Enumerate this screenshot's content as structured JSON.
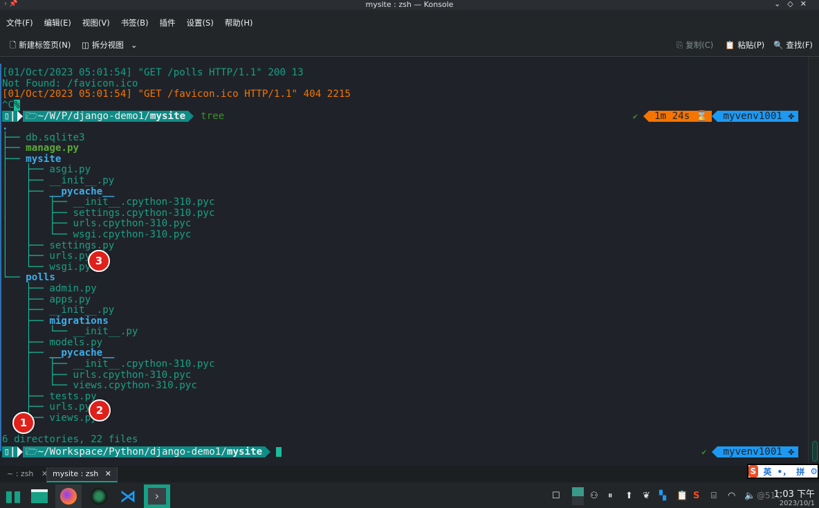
{
  "window": {
    "title": "mysite : zsh — Konsole",
    "controls": [
      "⌄",
      "◇",
      "✕"
    ]
  },
  "menu": [
    "文件(F)",
    "编辑(E)",
    "视图(V)",
    "书签(B)",
    "插件",
    "设置(S)",
    "帮助(H)"
  ],
  "toolbar": {
    "new_tab": "新建标签页(N)",
    "split_view": "拆分视图",
    "copy": "复制(C)",
    "paste": "粘贴(P)",
    "find": "查找(F)"
  },
  "terminal": {
    "log_lines": [
      [
        [
          "[01/Oct/2023 05:01:54] \"GET /polls HTTP/1.1\" 200 13",
          "teal"
        ]
      ],
      [
        [
          "Not Found: /favicon.ico",
          "teal"
        ]
      ],
      [
        [
          "[01/Oct/2023 05:01:54] \"GET /favicon.ico HTTP/1.1\" 404 2215",
          "orange"
        ]
      ],
      [
        [
          "^C",
          "teal"
        ],
        [
          "%",
          "cursor"
        ]
      ]
    ],
    "prompt1": {
      "path_prefix": "~/W/P/django-demo1/",
      "path_dir": "mysite",
      "command": "tree",
      "status": "✔",
      "duration": "1m 24s",
      "venv": "myvenv1001"
    },
    "tree_lines": [
      [
        [
          ".",
          "dir"
        ]
      ],
      [
        [
          "├── ",
          "br"
        ],
        [
          "db.sqlite3",
          "file"
        ]
      ],
      [
        [
          "├── ",
          "br"
        ],
        [
          "manage.py",
          "exec"
        ]
      ],
      [
        [
          "├── ",
          "br"
        ],
        [
          "mysite",
          "dir"
        ]
      ],
      [
        [
          "│   ├── ",
          "br"
        ],
        [
          "asgi.py",
          "file"
        ]
      ],
      [
        [
          "│   ├── ",
          "br"
        ],
        [
          "__init__.py",
          "file"
        ]
      ],
      [
        [
          "│   ├── ",
          "br"
        ],
        [
          "__pycache__",
          "dir"
        ]
      ],
      [
        [
          "│   │   ├── ",
          "br"
        ],
        [
          "__init__.cpython-310.pyc",
          "file"
        ]
      ],
      [
        [
          "│   │   ├── ",
          "br"
        ],
        [
          "settings.cpython-310.pyc",
          "file"
        ]
      ],
      [
        [
          "│   │   ├── ",
          "br"
        ],
        [
          "urls.cpython-310.pyc",
          "file"
        ]
      ],
      [
        [
          "│   │   └── ",
          "br"
        ],
        [
          "wsgi.cpython-310.pyc",
          "file"
        ]
      ],
      [
        [
          "│   ├── ",
          "br"
        ],
        [
          "settings.py",
          "file"
        ]
      ],
      [
        [
          "│   ├── ",
          "br"
        ],
        [
          "urls.py",
          "file"
        ]
      ],
      [
        [
          "│   └── ",
          "br"
        ],
        [
          "wsgi.py",
          "file"
        ]
      ],
      [
        [
          "└── ",
          "br"
        ],
        [
          "polls",
          "dir"
        ]
      ],
      [
        [
          "    ├── ",
          "br"
        ],
        [
          "admin.py",
          "file"
        ]
      ],
      [
        [
          "    ├── ",
          "br"
        ],
        [
          "apps.py",
          "file"
        ]
      ],
      [
        [
          "    ├── ",
          "br"
        ],
        [
          "__init__.py",
          "file"
        ]
      ],
      [
        [
          "    ├── ",
          "br"
        ],
        [
          "migrations",
          "dir"
        ]
      ],
      [
        [
          "    │   └── ",
          "br"
        ],
        [
          "__init__.py",
          "file"
        ]
      ],
      [
        [
          "    ├── ",
          "br"
        ],
        [
          "models.py",
          "file"
        ]
      ],
      [
        [
          "    ├── ",
          "br"
        ],
        [
          "__pycache__",
          "dir"
        ]
      ],
      [
        [
          "    │   ├── ",
          "br"
        ],
        [
          "__init__.cpython-310.pyc",
          "file"
        ]
      ],
      [
        [
          "    │   ├── ",
          "br"
        ],
        [
          "urls.cpython-310.pyc",
          "file"
        ]
      ],
      [
        [
          "    │   └── ",
          "br"
        ],
        [
          "views.cpython-310.pyc",
          "file"
        ]
      ],
      [
        [
          "    ├── ",
          "br"
        ],
        [
          "tests.py",
          "file"
        ]
      ],
      [
        [
          "    ├── ",
          "br"
        ],
        [
          "urls.py",
          "file"
        ]
      ],
      [
        [
          "    └── ",
          "br"
        ],
        [
          "views.py",
          "file"
        ]
      ],
      [
        [
          "",
          "file"
        ]
      ],
      [
        [
          "6 directories, 22 files",
          "teal"
        ]
      ]
    ],
    "prompt2": {
      "path_prefix": "~/Workspace/Python/django-demo1/",
      "path_dir": "mysite",
      "status": "✔",
      "venv": "myvenv1001"
    }
  },
  "annotations": [
    "1",
    "2",
    "3"
  ],
  "tabs": [
    {
      "label": "~ : zsh"
    },
    {
      "label": "mysite : zsh",
      "active": true
    }
  ],
  "ime": {
    "lang": "英",
    "punct": "•，",
    "mode": "拼"
  },
  "clock": {
    "time": "1:03 下午",
    "date": "2023/10/1"
  },
  "watermark": "@51C",
  "colors": {
    "accent": "#16a085",
    "dir": "#3daee9",
    "orange": "#f67400",
    "venv": "#1d99f3",
    "marker": "#e0201b"
  }
}
